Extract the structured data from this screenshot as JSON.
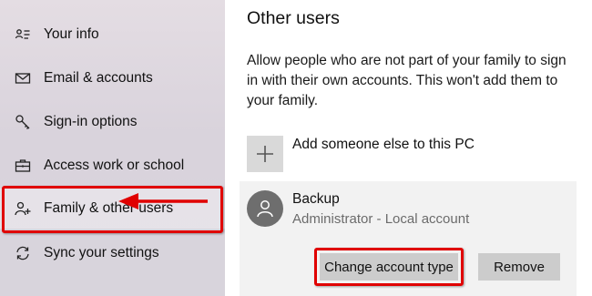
{
  "sidebar": {
    "items": [
      {
        "label": "Your info",
        "icon": "contact-card-icon"
      },
      {
        "label": "Email & accounts",
        "icon": "mail-icon"
      },
      {
        "label": "Sign-in options",
        "icon": "key-icon"
      },
      {
        "label": "Access work or school",
        "icon": "briefcase-icon"
      },
      {
        "label": "Family & other users",
        "icon": "add-person-icon",
        "selected": true
      },
      {
        "label": "Sync your settings",
        "icon": "sync-icon"
      }
    ]
  },
  "main": {
    "title": "Other users",
    "description": "Allow people who are not part of your family to sign in with their own accounts. This won't add them to your family.",
    "add_label": "Add someone else to this PC",
    "account": {
      "name": "Backup",
      "subtitle": "Administrator - Local account",
      "change_button": "Change account type",
      "remove_button": "Remove"
    }
  },
  "colors": {
    "highlight": "#e00000",
    "button_bg": "#cccccc",
    "avatar_bg": "#6e6e6e",
    "panel_bg": "#f2f2f2"
  }
}
